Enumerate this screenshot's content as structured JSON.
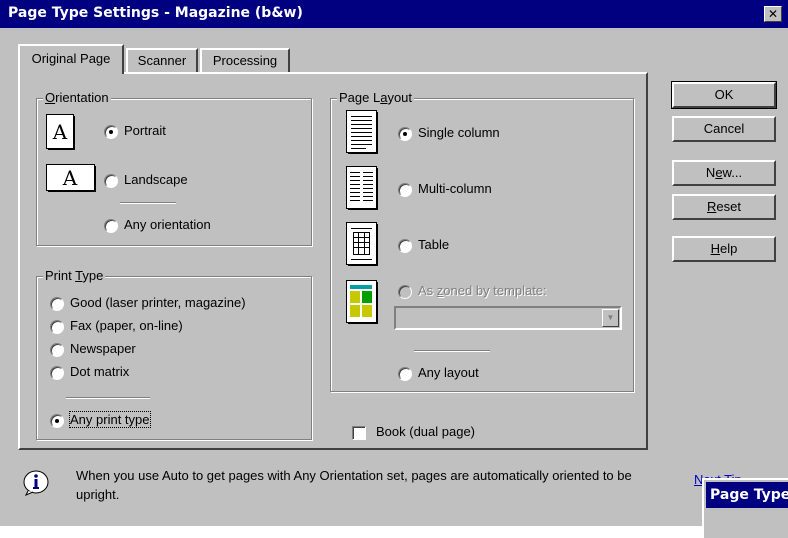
{
  "window": {
    "title": "Page Type Settings - Magazine (b&w)",
    "close_glyph": "✕"
  },
  "tabs": [
    {
      "label": "Original Page",
      "active": true
    },
    {
      "label": "Scanner",
      "active": false
    },
    {
      "label": "Processing",
      "active": false
    }
  ],
  "orientation": {
    "legend_key": "O",
    "legend_rest": "rientation",
    "options": [
      {
        "label": "Portrait",
        "selected": true,
        "icon": "portrait-page-icon"
      },
      {
        "label": "Landscape",
        "selected": false,
        "icon": "landscape-page-icon"
      },
      {
        "label": "Any orientation",
        "selected": false
      }
    ]
  },
  "print_type": {
    "legend_pre": "Print ",
    "legend_key": "T",
    "legend_rest": "ype",
    "options": [
      {
        "label": "Good (laser printer, magazine)",
        "selected": false
      },
      {
        "label": "Fax (paper, on-line)",
        "selected": false
      },
      {
        "label": "Newspaper",
        "selected": false
      },
      {
        "label": "Dot matrix",
        "selected": false
      },
      {
        "label": "Any print type",
        "selected": true
      }
    ]
  },
  "page_layout": {
    "legend_pre": "Page L",
    "legend_key": "a",
    "legend_rest": "yout",
    "options": [
      {
        "label": "Single column",
        "selected": true,
        "icon": "single-column-icon"
      },
      {
        "label": "Multi-column",
        "selected": false,
        "icon": "multi-column-icon"
      },
      {
        "label": "Table",
        "selected": false,
        "icon": "table-layout-icon"
      },
      {
        "label_pre": "As ",
        "label_key": "z",
        "label_rest": "oned by template:",
        "selected": false,
        "disabled": true,
        "icon": "zoned-template-icon"
      },
      {
        "label": "Any layout",
        "selected": false
      }
    ],
    "template_select_value": ""
  },
  "book": {
    "label": "Book (dual page)",
    "checked": false
  },
  "buttons": {
    "ok": "OK",
    "cancel": "Cancel",
    "new_pre": "N",
    "new_key": "e",
    "new_rest": "w...",
    "reset_key": "R",
    "reset_rest": "eset",
    "help_key": "H",
    "help_rest": "elp"
  },
  "tip": {
    "icon": "info-icon",
    "text": "When you use Auto to get pages with Any Orientation set, pages are automatically oriented to be upright.",
    "next_link": "Next Tip"
  },
  "background_window": {
    "title": "Page Type"
  },
  "colors": {
    "face": "#c0c0c0",
    "titlebar": "#000080",
    "link": "#0000c0"
  }
}
